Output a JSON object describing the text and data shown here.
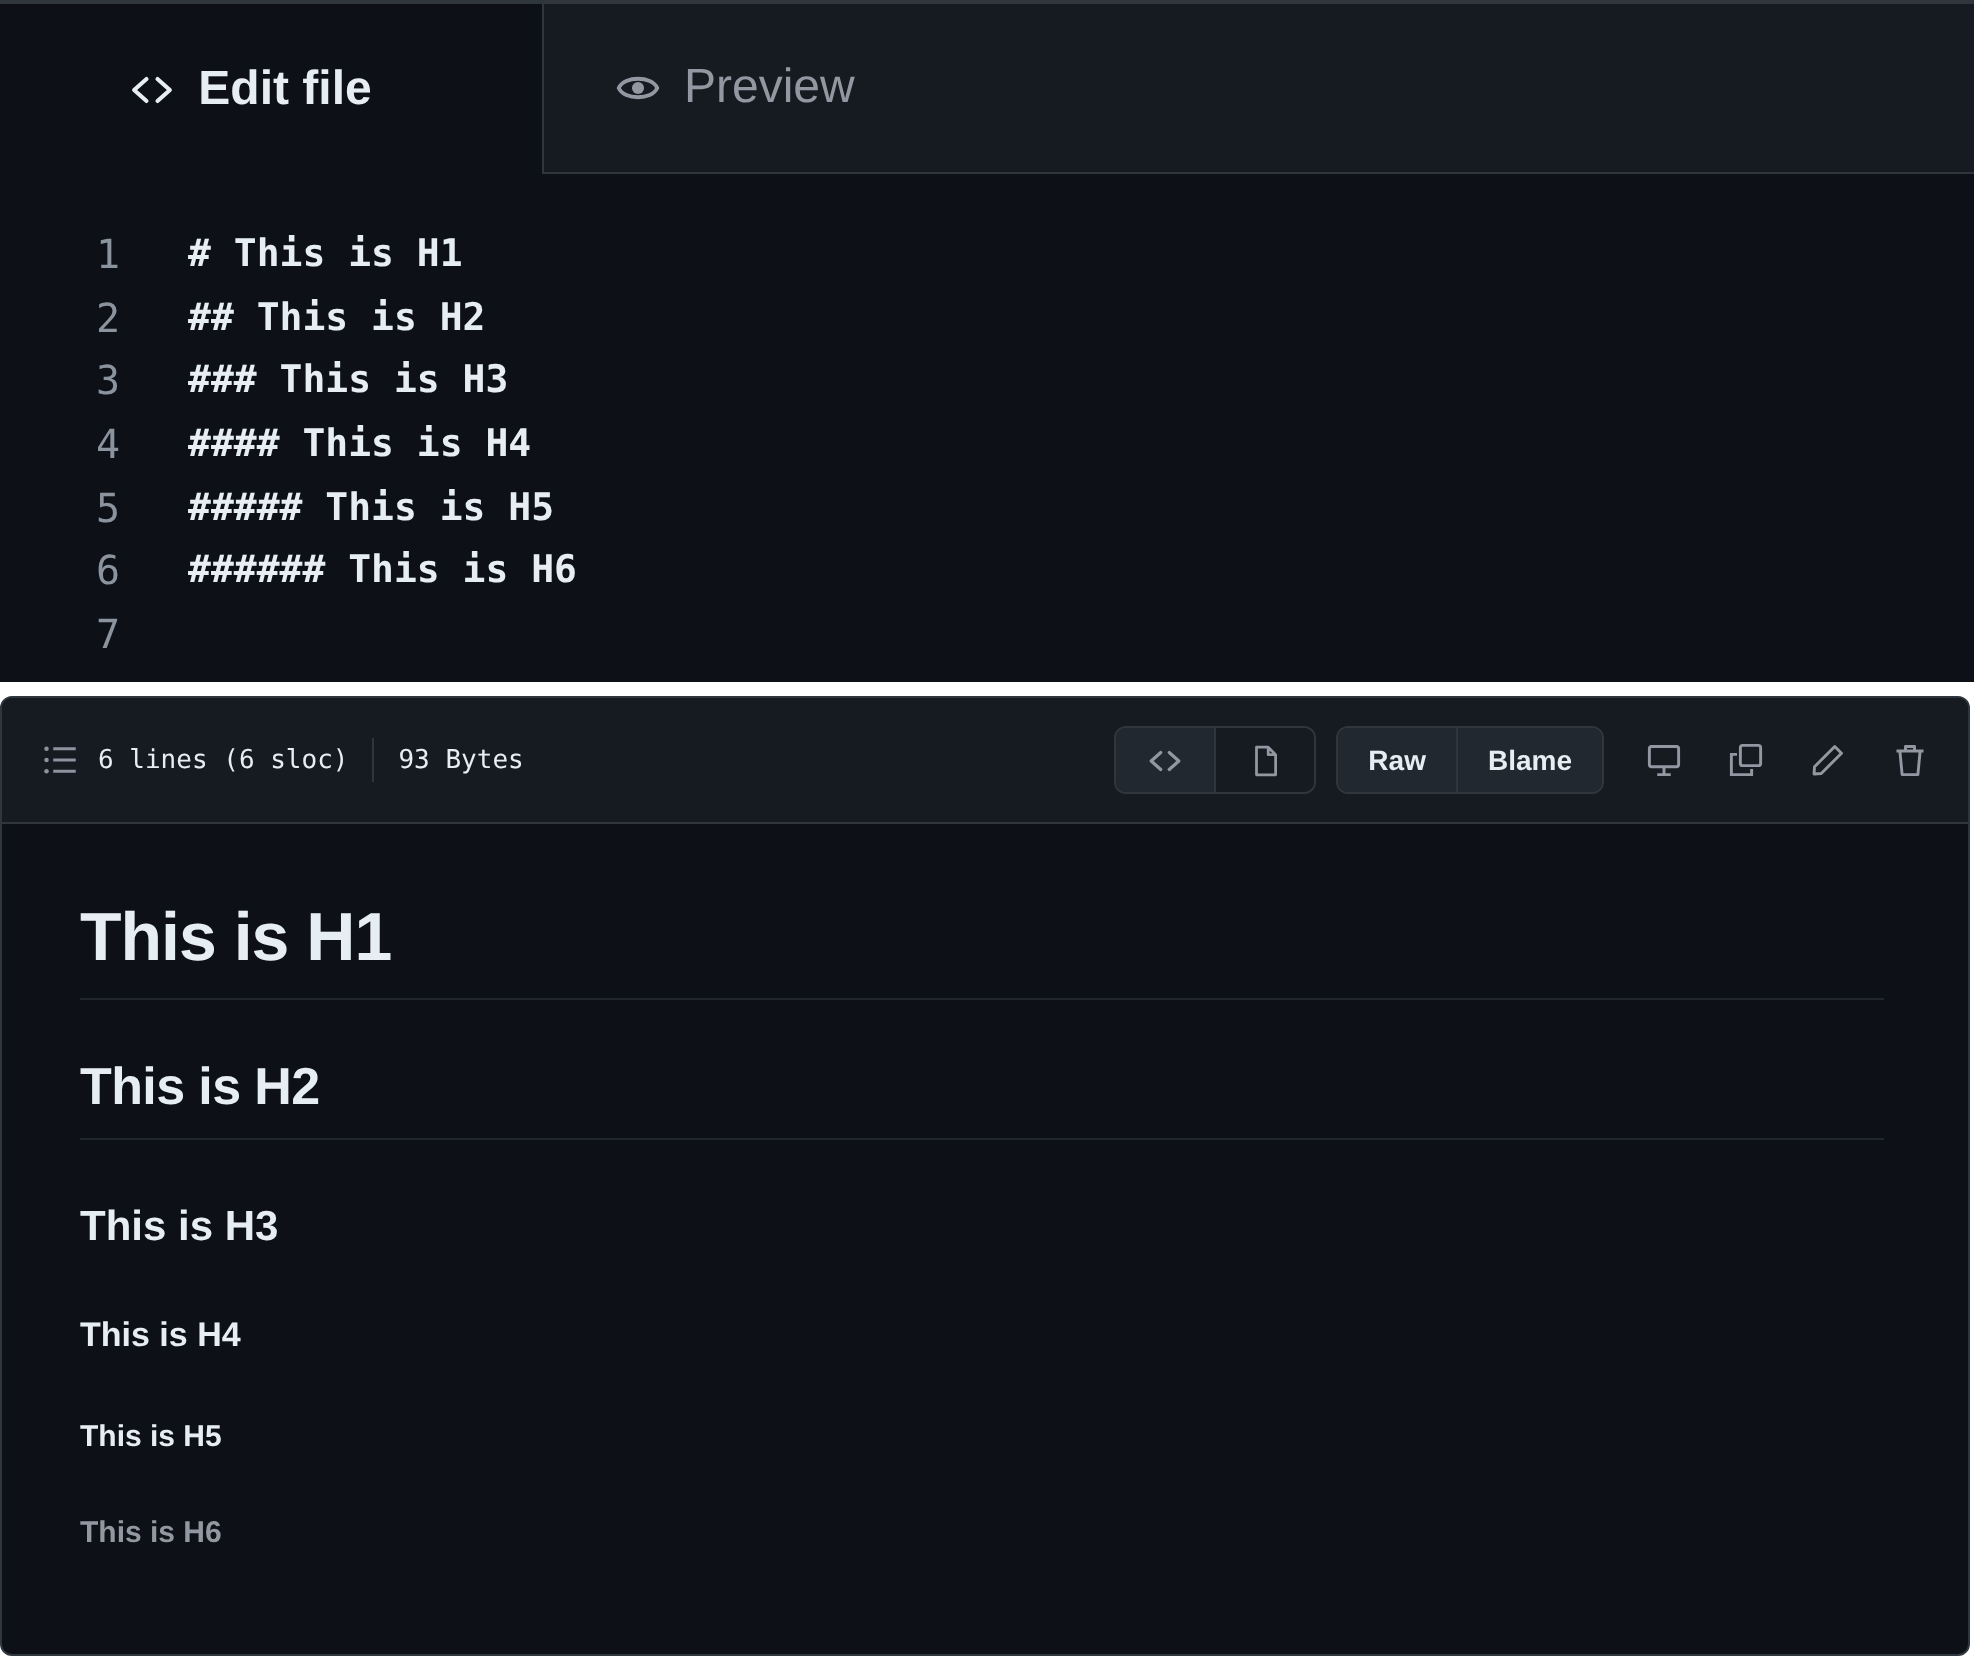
{
  "tabs": [
    {
      "label": "Edit file",
      "kind": "code",
      "selected": true
    },
    {
      "label": "Preview",
      "kind": "eye",
      "selected": false
    }
  ],
  "editor": {
    "lines": [
      {
        "number": "1",
        "code": "# This is H1"
      },
      {
        "number": "2",
        "code": "## This is H2"
      },
      {
        "number": "3",
        "code": "### This is H3"
      },
      {
        "number": "4",
        "code": "#### This is H4"
      },
      {
        "number": "5",
        "code": "##### This is H5"
      },
      {
        "number": "6",
        "code": "###### This is H6"
      },
      {
        "number": "7"
      }
    ]
  },
  "file_view": {
    "line_info": "6 lines (6 sloc)",
    "size": "93 Bytes",
    "view_toggle": [
      {
        "kind": "code",
        "selected": true
      },
      {
        "kind": "file",
        "selected": false
      }
    ],
    "buttons": [
      "Raw",
      "Blame"
    ],
    "actions": [
      {
        "kind": "monitor"
      },
      {
        "kind": "copy"
      },
      {
        "kind": "pencil"
      },
      {
        "kind": "trash"
      }
    ],
    "headings": [
      {
        "kind": "h1",
        "text": "This is H1"
      },
      {
        "kind": "h2",
        "text": "This is H2"
      },
      {
        "kind": "h3",
        "text": "This is H3"
      },
      {
        "kind": "h4",
        "text": "This is H4"
      },
      {
        "kind": "h5",
        "text": "This is H5"
      },
      {
        "kind": "h6",
        "text": "This is H6"
      }
    ]
  }
}
